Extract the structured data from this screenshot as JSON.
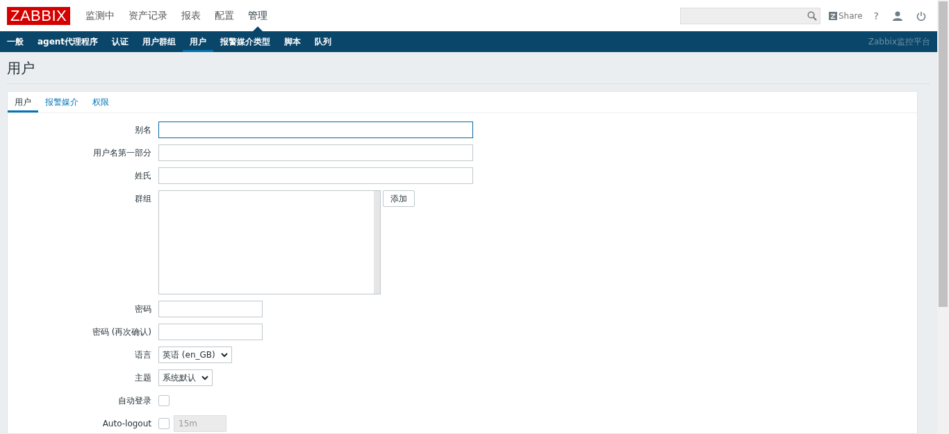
{
  "logo": "ZABBIX",
  "main_menu": [
    {
      "label": "监测中",
      "selected": false
    },
    {
      "label": "资产记录",
      "selected": false
    },
    {
      "label": "报表",
      "selected": false
    },
    {
      "label": "配置",
      "selected": false
    },
    {
      "label": "管理",
      "selected": true
    }
  ],
  "header": {
    "share": "Share",
    "help": "?"
  },
  "sub_menu": [
    {
      "label": "一般",
      "selected": false
    },
    {
      "label": "agent代理程序",
      "selected": false
    },
    {
      "label": "认证",
      "selected": false
    },
    {
      "label": "用户群组",
      "selected": false
    },
    {
      "label": "用户",
      "selected": true
    },
    {
      "label": "报警媒介类型",
      "selected": false
    },
    {
      "label": "脚本",
      "selected": false
    },
    {
      "label": "队列",
      "selected": false
    }
  ],
  "server_name": "Zabbix监控平台",
  "page_title": "用户",
  "tabs": [
    {
      "label": "用户",
      "selected": true
    },
    {
      "label": "报警媒介",
      "selected": false
    },
    {
      "label": "权限",
      "selected": false
    }
  ],
  "form": [
    {
      "kind": "text",
      "label": "别名",
      "focused": true
    },
    {
      "kind": "text",
      "label": "用户名第一部分",
      "focused": false
    },
    {
      "kind": "text",
      "label": "姓氏",
      "focused": false
    },
    {
      "kind": "listbox",
      "label": "群组",
      "button": "添加"
    },
    {
      "kind": "password",
      "label": "密码"
    },
    {
      "kind": "password",
      "label": "密码 (再次确认)"
    },
    {
      "kind": "select",
      "label": "语言",
      "value": "英语 (en_GB)"
    },
    {
      "kind": "select",
      "label": "主题",
      "value": "系统默认"
    },
    {
      "kind": "checkbox",
      "label": "自动登录",
      "checked": false
    },
    {
      "kind": "checkbox_input",
      "label": "Auto-logout",
      "checked": false,
      "value": "15m",
      "disabled": true
    }
  ]
}
